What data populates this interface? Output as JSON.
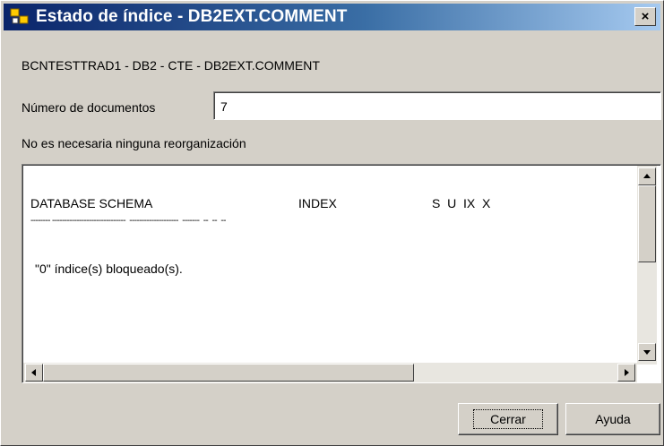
{
  "window": {
    "title": "Estado de índice - DB2EXT.COMMENT",
    "close_glyph": "×"
  },
  "path_text": "BCNTESTTRAD1 - DB2 - CTE - DB2EXT.COMMENT",
  "docs": {
    "label": "Número de documentos",
    "value": "7"
  },
  "status_message": "No es necesaria ninguna reorganización",
  "output": {
    "header_col1": "DATABASE SCHEMA",
    "header_col2": "INDEX",
    "header_col3": "S  U  IX  X",
    "separator": "-------- ------------------------------  --------------------  -------  --  --  --",
    "locked_message": "\"0\" índice(s) bloqueado(s)."
  },
  "buttons": {
    "close": "Cerrar",
    "help": "Ayuda"
  },
  "icons": {
    "app": "db2-app-icon",
    "scroll_up": "up-arrow-icon",
    "scroll_down": "down-arrow-icon",
    "scroll_left": "left-arrow-icon",
    "scroll_right": "right-arrow-icon"
  }
}
